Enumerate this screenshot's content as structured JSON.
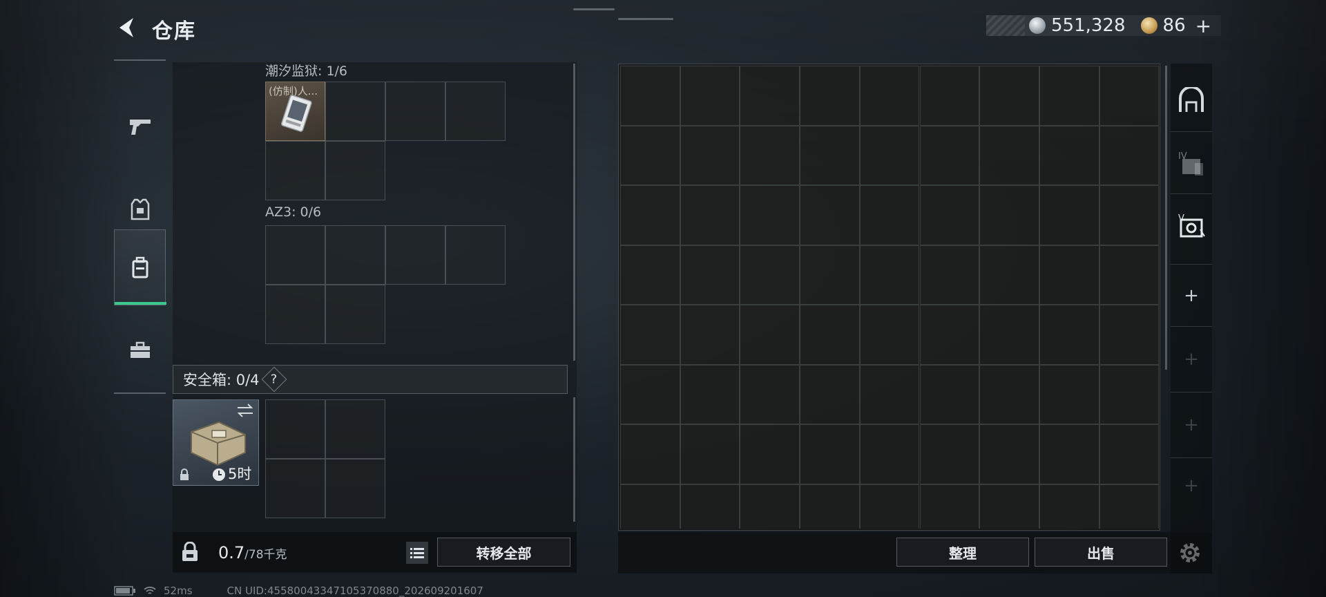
{
  "header": {
    "title": "仓库",
    "silver_amount": "551,328",
    "gold_amount": "86"
  },
  "left_nav": {
    "items": [
      "weapon",
      "armor",
      "backpack",
      "toolbox"
    ],
    "active_index": 2
  },
  "backpack": {
    "sections": [
      {
        "label": "潮汐监狱: 1/6",
        "item_name": "(仿制)人..."
      },
      {
        "label": "AZ3: 0/6"
      }
    ],
    "safe_box_label": "安全箱: 0/4",
    "safe_box_help": "?",
    "case_timer": "5时",
    "weight_value": "0.7",
    "weight_capacity": "/78千克",
    "transfer_all_label": "转移全部"
  },
  "stash": {
    "sort_label": "整理",
    "sell_label": "出售"
  },
  "status": {
    "ping": "52ms",
    "uid": "CN UID:45580043347105370880_202609201607"
  },
  "colors": {
    "accent_green": "#39c98a",
    "panel_bg": "#161a1e",
    "grid_line": "#8c969b"
  }
}
